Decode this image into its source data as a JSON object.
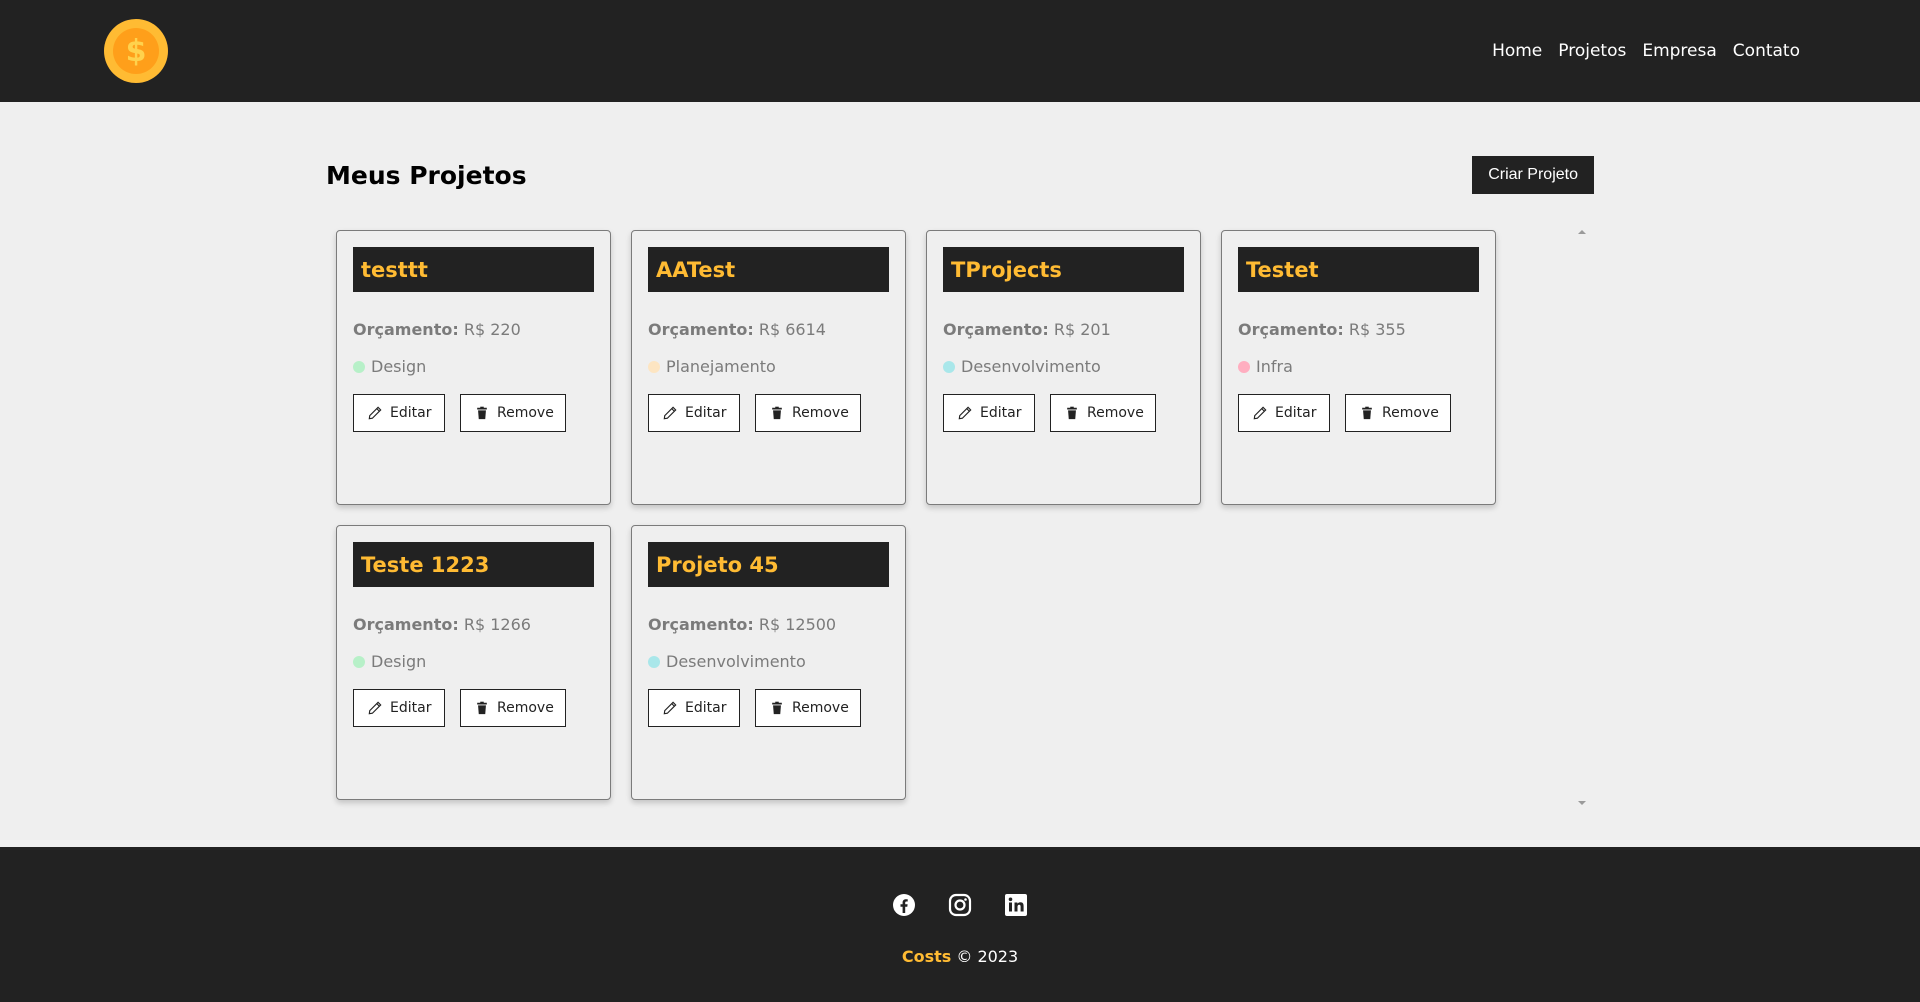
{
  "nav": {
    "logo_icon": "coin-dollar-icon",
    "logo_symbol": "$",
    "links": [
      "Home",
      "Projetos",
      "Empresa",
      "Contato"
    ]
  },
  "main": {
    "title": "Meus Projetos",
    "create_label": "Criar Projeto"
  },
  "labels": {
    "budget": "Orçamento:",
    "edit": "Editar",
    "remove": "Remove"
  },
  "projects": [
    {
      "name": "testtt",
      "budget": "R$ 220",
      "category": "Design",
      "dot_color": "#b7f0c8"
    },
    {
      "name": "AATest",
      "budget": "R$ 6614",
      "category": "Planejamento",
      "dot_color": "#fde5c2"
    },
    {
      "name": "TProjects",
      "budget": "R$ 201",
      "category": "Desenvolvimento",
      "dot_color": "#a9e7ea"
    },
    {
      "name": "Testet",
      "budget": "R$ 355",
      "category": "Infra",
      "dot_color": "#ffaec0"
    },
    {
      "name": "Teste 1223",
      "budget": "R$ 1266",
      "category": "Design",
      "dot_color": "#b7f0c8"
    },
    {
      "name": "Projeto 45",
      "budget": "R$ 12500",
      "category": "Desenvolvimento",
      "dot_color": "#a9e7ea"
    }
  ],
  "footer": {
    "socials": [
      "facebook-icon",
      "instagram-icon",
      "linkedin-icon"
    ],
    "brand": "Costs",
    "copyright": "© 2023"
  },
  "colors": {
    "dark": "#222222",
    "accent": "#ffbb33",
    "background": "#efefef"
  }
}
